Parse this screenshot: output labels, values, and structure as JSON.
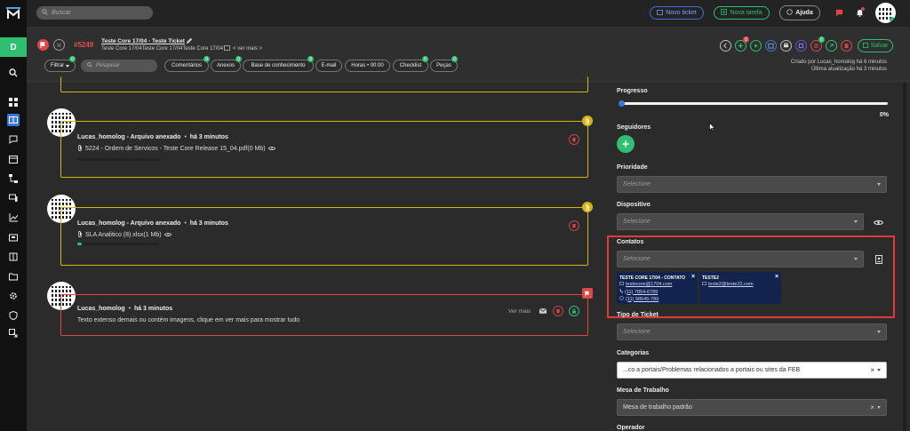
{
  "topbar": {
    "search_placeholder": "Buscar",
    "new_ticket_label": "Novo ticket",
    "new_task_label": "Nova tarefa",
    "help_label": "Ajuda"
  },
  "sidebar": {
    "workspace_letter": "D"
  },
  "ticket": {
    "number": "#5249",
    "title": "Teste Core 17/04 - Teste Ticket",
    "subtitle": "Teste Core 17/04Teste Core 17/04Teste Core 17/04",
    "see_more": "< ver mais >",
    "save_label": "Salvar",
    "created_by": "Criado por Lucas_homolog há 6 minutos",
    "last_update": "Última atualização há 3 minutos",
    "action_badges": [
      "0",
      "0"
    ]
  },
  "tabs": [
    {
      "label": "Filtrar",
      "badge": "0"
    },
    {
      "label": "Pesquisar"
    },
    {
      "label": "Comentários",
      "badge": "0"
    },
    {
      "label": "Anexos",
      "badge": "0"
    },
    {
      "label": "Base de conhecimento",
      "badge": "0"
    },
    {
      "label": "E-mail"
    },
    {
      "label": "Horas • 00:00"
    },
    {
      "label": "Checklist",
      "badge": "0"
    },
    {
      "label": "Peças",
      "badge": "0"
    }
  ],
  "timeline": [
    {
      "author": "Lucas_homolog - Arquivo anexado",
      "time": "há 3 minutos",
      "file": "5224 - Ordem de Servicos - Teste Core Release 15_04.pdf(0 Mb)",
      "progress": 0.0
    },
    {
      "author": "Lucas_homolog - Arquivo anexado",
      "time": "há 3 minutos",
      "file": "SLA Analitico (8).xlsx(1 Mb)",
      "progress": 0.05
    },
    {
      "author": "Lucas_homolog",
      "time": "há 3 minutos",
      "text": "Texto extenso demais ou contém imagens, clique em ver mais para mostrar tudo",
      "see_more": "Ver mais"
    }
  ],
  "panel": {
    "progress_label": "Progresso",
    "progress_value": "0%",
    "progress_fraction": 0.0,
    "followers_label": "Seguidores",
    "priority_label": "Prioridade",
    "priority_value": "Selecione",
    "device_label": "Dispositivo",
    "device_value": "Selecione",
    "contacts_label": "Contatos",
    "contacts_value": "Selecione",
    "contacts": [
      {
        "name": "TESTE CORE 17/04 - CONTATO",
        "email": "testecore@1704.com",
        "phone": "(11) 7854-6789",
        "whatsapp": "(11) 98545-789"
      },
      {
        "name": "TESTE2",
        "email": "teste2@teste22.com"
      }
    ],
    "ticket_type_label": "Tipo de Ticket",
    "ticket_type_value": "Selecione",
    "categories_label": "Categorias",
    "categories_value": "...co a portais/Problemas relacionados a portais ou sites da FEB",
    "desk_label": "Mesa de Trabalho",
    "desk_value": "Mesa de trabalho padrão",
    "operator_label": "Operador"
  },
  "colors": {
    "brand_green": "#2fbf71",
    "highlight_red": "#e53935",
    "contact_card_bg": "#12244d",
    "flag_red": "#e04646",
    "ticket_number": "#e05050",
    "card_yellow": "#d7b317"
  }
}
